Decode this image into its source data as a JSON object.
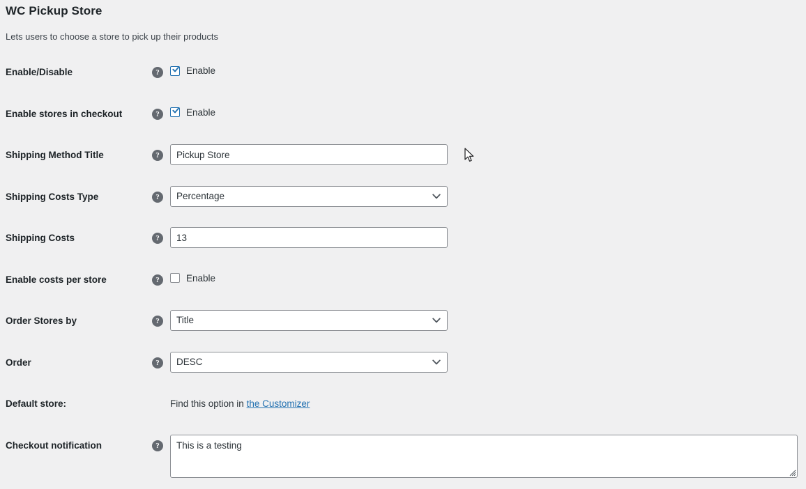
{
  "page": {
    "title": "WC Pickup Store",
    "description": "Lets users to choose a store to pick up their products"
  },
  "icons": {
    "help": "?",
    "help_icon_name": "help-icon",
    "chevron": "chevron-down-icon",
    "resize": "resize-grip-icon",
    "cursor": "mouse-pointer-icon"
  },
  "colors": {
    "background": "#f0f0f1",
    "text": "#1d2327",
    "link": "#2271b1",
    "checkbox_checked_border": "#2271b1",
    "checkbox_unchecked_border": "#8c8f94",
    "input_border": "#8c8f94",
    "help_icon_bg": "#646970"
  },
  "rows": [
    {
      "id": "enable-disable",
      "label": "Enable/Disable",
      "type": "checkbox",
      "checkbox_label": "Enable",
      "checked": true
    },
    {
      "id": "enable-stores-in-checkout",
      "label": "Enable stores in checkout",
      "type": "checkbox",
      "checkbox_label": "Enable",
      "checked": true
    },
    {
      "id": "shipping-method-title",
      "label": "Shipping Method Title",
      "type": "text",
      "value": "Pickup Store",
      "placeholder": ""
    },
    {
      "id": "shipping-costs-type",
      "label": "Shipping Costs Type",
      "type": "select",
      "value": "Percentage"
    },
    {
      "id": "shipping-costs",
      "label": "Shipping Costs",
      "type": "text",
      "value": "13",
      "placeholder": ""
    },
    {
      "id": "enable-costs-per-store",
      "label": "Enable costs per store",
      "type": "checkbox",
      "checkbox_label": "Enable",
      "checked": false
    },
    {
      "id": "order-stores-by",
      "label": "Order Stores by",
      "type": "select",
      "value": "Title"
    },
    {
      "id": "order",
      "label": "Order",
      "type": "select",
      "value": "DESC"
    },
    {
      "id": "default-store",
      "label": "Default store:",
      "type": "link_text",
      "text_before": "Find this option in ",
      "link_text": "the Customizer"
    },
    {
      "id": "checkout-notification",
      "label": "Checkout notification",
      "type": "textarea",
      "value": "This is a testing",
      "placeholder": ""
    }
  ]
}
